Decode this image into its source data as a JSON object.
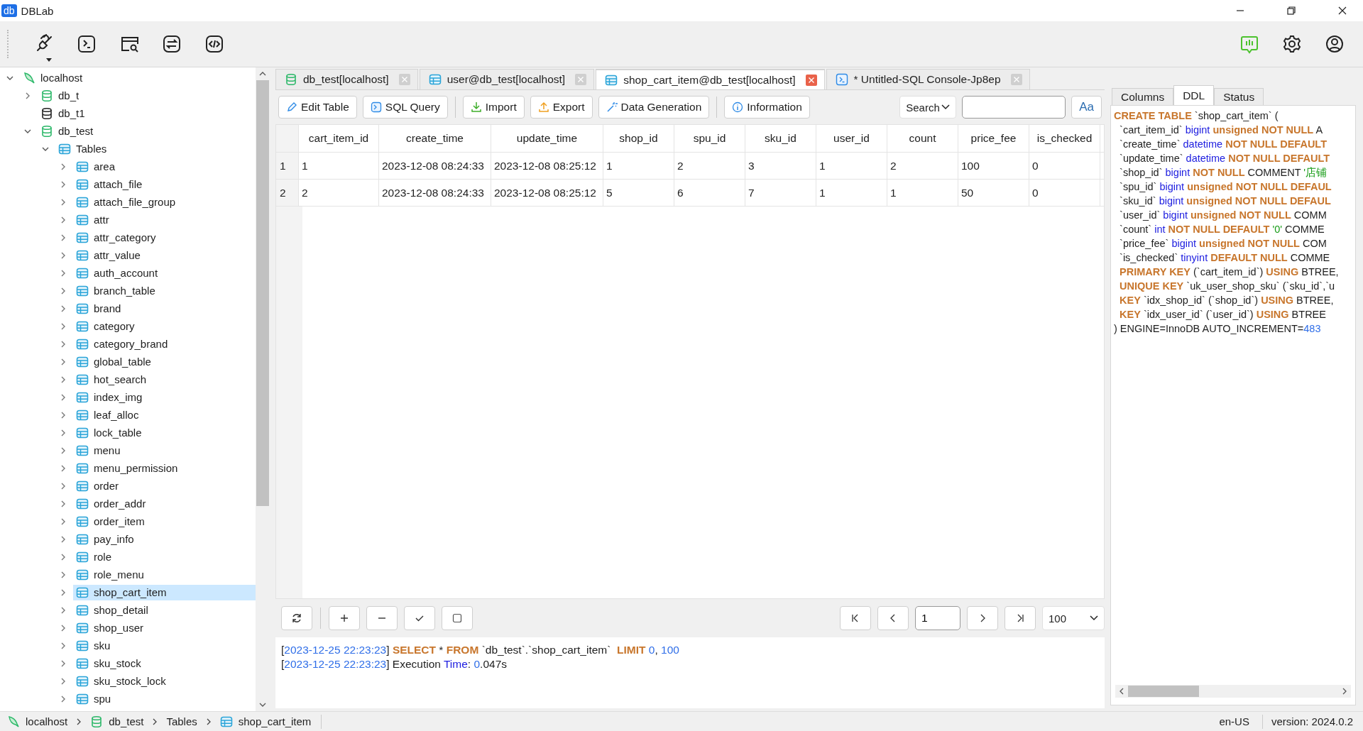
{
  "window": {
    "logo": "db",
    "title": "DBLab"
  },
  "toolbar": {
    "left": [
      {
        "kind": "plug-menu"
      },
      {
        "kind": "terminal"
      },
      {
        "kind": "window-search"
      },
      {
        "kind": "swap"
      },
      {
        "kind": "code"
      }
    ],
    "right": [
      {
        "kind": "feedback"
      },
      {
        "kind": "settings"
      },
      {
        "kind": "account"
      }
    ]
  },
  "tree": [
    {
      "label": "localhost",
      "kind": "server",
      "expanded": true,
      "selected": false,
      "children": [
        {
          "label": "db_t",
          "kind": "database",
          "expanded": false,
          "selected": false
        },
        {
          "label": "db_t1",
          "kind": "database-offline",
          "selected": false
        },
        {
          "label": "db_test",
          "kind": "database",
          "expanded": true,
          "selected": false,
          "children": [
            {
              "label": "Tables",
              "kind": "folder",
              "expanded": true,
              "selected": false,
              "children": [
                {
                  "label": "area",
                  "kind": "table",
                  "expanded": false,
                  "selected": false
                },
                {
                  "label": "attach_file",
                  "kind": "table",
                  "expanded": false,
                  "selected": false
                },
                {
                  "label": "attach_file_group",
                  "kind": "table",
                  "expanded": false,
                  "selected": false
                },
                {
                  "label": "attr",
                  "kind": "table",
                  "expanded": false,
                  "selected": false
                },
                {
                  "label": "attr_category",
                  "kind": "table",
                  "expanded": false,
                  "selected": false
                },
                {
                  "label": "attr_value",
                  "kind": "table",
                  "expanded": false,
                  "selected": false
                },
                {
                  "label": "auth_account",
                  "kind": "table",
                  "expanded": false,
                  "selected": false
                },
                {
                  "label": "branch_table",
                  "kind": "table",
                  "expanded": false,
                  "selected": false
                },
                {
                  "label": "brand",
                  "kind": "table",
                  "expanded": false,
                  "selected": false
                },
                {
                  "label": "category",
                  "kind": "table",
                  "expanded": false,
                  "selected": false
                },
                {
                  "label": "category_brand",
                  "kind": "table",
                  "expanded": false,
                  "selected": false
                },
                {
                  "label": "global_table",
                  "kind": "table",
                  "expanded": false,
                  "selected": false
                },
                {
                  "label": "hot_search",
                  "kind": "table",
                  "expanded": false,
                  "selected": false
                },
                {
                  "label": "index_img",
                  "kind": "table",
                  "expanded": false,
                  "selected": false
                },
                {
                  "label": "leaf_alloc",
                  "kind": "table",
                  "expanded": false,
                  "selected": false
                },
                {
                  "label": "lock_table",
                  "kind": "table",
                  "expanded": false,
                  "selected": false
                },
                {
                  "label": "menu",
                  "kind": "table",
                  "expanded": false,
                  "selected": false
                },
                {
                  "label": "menu_permission",
                  "kind": "table",
                  "expanded": false,
                  "selected": false
                },
                {
                  "label": "order",
                  "kind": "table",
                  "expanded": false,
                  "selected": false
                },
                {
                  "label": "order_addr",
                  "kind": "table",
                  "expanded": false,
                  "selected": false
                },
                {
                  "label": "order_item",
                  "kind": "table",
                  "expanded": false,
                  "selected": false
                },
                {
                  "label": "pay_info",
                  "kind": "table",
                  "expanded": false,
                  "selected": false
                },
                {
                  "label": "role",
                  "kind": "table",
                  "expanded": false,
                  "selected": false
                },
                {
                  "label": "role_menu",
                  "kind": "table",
                  "expanded": false,
                  "selected": false
                },
                {
                  "label": "shop_cart_item",
                  "kind": "table",
                  "expanded": false,
                  "selected": true
                },
                {
                  "label": "shop_detail",
                  "kind": "table",
                  "expanded": false,
                  "selected": false
                },
                {
                  "label": "shop_user",
                  "kind": "table",
                  "expanded": false,
                  "selected": false
                },
                {
                  "label": "sku",
                  "kind": "table",
                  "expanded": false,
                  "selected": false
                },
                {
                  "label": "sku_stock",
                  "kind": "table",
                  "expanded": false,
                  "selected": false
                },
                {
                  "label": "sku_stock_lock",
                  "kind": "table",
                  "expanded": false,
                  "selected": false
                },
                {
                  "label": "spu",
                  "kind": "table",
                  "expanded": false,
                  "selected": false
                }
              ]
            }
          ]
        }
      ]
    }
  ],
  "tabs": [
    {
      "label": "db_test[localhost]",
      "kind": "database",
      "selected": false
    },
    {
      "label": "user@db_test[localhost]",
      "kind": "table",
      "selected": false
    },
    {
      "label": "shop_cart_item@db_test[localhost]",
      "kind": "table",
      "selected": true
    },
    {
      "label": "* Untitled-SQL Console-Jp8ep",
      "kind": "console",
      "selected": false
    }
  ],
  "action_groups": [
    [
      {
        "label": "Edit Table",
        "kind": "edit"
      },
      {
        "label": "SQL Query",
        "kind": "query"
      }
    ],
    [
      {
        "label": "Import",
        "kind": "import"
      },
      {
        "label": "Export",
        "kind": "export"
      },
      {
        "label": "Data Generation",
        "kind": "generate"
      }
    ],
    [
      {
        "label": "Information",
        "kind": "info"
      }
    ]
  ],
  "search": {
    "mode": "Search",
    "case_button": "Aa"
  },
  "grid": {
    "columns": [
      "cart_item_id",
      "create_time",
      "update_time",
      "shop_id",
      "spu_id",
      "sku_id",
      "user_id",
      "count",
      "price_fee",
      "is_checked"
    ],
    "rows": [
      {
        "number": "1",
        "cells": [
          "1",
          "2023-12-08 08:24:33",
          "2023-12-08 08:25:12",
          "1",
          "2",
          "3",
          "1",
          "2",
          "100",
          "0"
        ]
      },
      {
        "number": "2",
        "cells": [
          "2",
          "2023-12-08 08:24:33",
          "2023-12-08 08:25:12",
          "5",
          "6",
          "7",
          "1",
          "1",
          "50",
          "0"
        ]
      }
    ]
  },
  "grid_tools": [
    {
      "kind": "refresh"
    },
    {
      "kind": "add"
    },
    {
      "kind": "remove"
    },
    {
      "kind": "apply"
    },
    {
      "kind": "cancel"
    }
  ],
  "pager": {
    "page": "1",
    "page_size": "100"
  },
  "log": [
    [
      {
        "text": "[",
        "kind": "plain"
      },
      {
        "text": "2023-12-25 22:23:23",
        "kind": "num"
      },
      {
        "text": "] ",
        "kind": "plain"
      },
      {
        "text": "SELECT",
        "kind": "kw"
      },
      {
        "text": " * ",
        "kind": "plain"
      },
      {
        "text": "FROM",
        "kind": "kw"
      },
      {
        "text": " `db_test`.`shop_cart_item`  ",
        "kind": "plain"
      },
      {
        "text": "LIMIT",
        "kind": "kw"
      },
      {
        "text": " 0",
        "kind": "num"
      },
      {
        "text": ", ",
        "kind": "plain"
      },
      {
        "text": "100",
        "kind": "num"
      }
    ],
    [
      {
        "text": "[",
        "kind": "plain"
      },
      {
        "text": "2023-12-25 22:23:23",
        "kind": "num"
      },
      {
        "text": "] Execution ",
        "kind": "plain"
      },
      {
        "text": "Time",
        "kind": "type"
      },
      {
        "text": ": ",
        "kind": "plain"
      },
      {
        "text": "0",
        "kind": "num"
      },
      {
        "text": ".047s",
        "kind": "plain"
      }
    ]
  ],
  "side_tabs": [
    {
      "label": "Columns",
      "selected": false
    },
    {
      "label": "DDL",
      "selected": true
    },
    {
      "label": "Status",
      "selected": false
    }
  ],
  "ddl": [
    [
      {
        "text": "CREATE TABLE",
        "kind": "kw"
      },
      {
        "text": " `shop_cart_item` (",
        "kind": "plain"
      }
    ],
    [
      {
        "text": "  `cart_item_id` ",
        "kind": "plain"
      },
      {
        "text": "bigint",
        "kind": "type"
      },
      {
        "text": " unsigned NOT NULL",
        "kind": "kw"
      },
      {
        "text": " A",
        "kind": "plain"
      }
    ],
    [
      {
        "text": "  `create_time` ",
        "kind": "plain"
      },
      {
        "text": "datetime",
        "kind": "type"
      },
      {
        "text": " NOT NULL DEFAULT",
        "kind": "kw"
      }
    ],
    [
      {
        "text": "  `update_time` ",
        "kind": "plain"
      },
      {
        "text": "datetime",
        "kind": "type"
      },
      {
        "text": " NOT NULL DEFAULT",
        "kind": "kw"
      }
    ],
    [
      {
        "text": "  `shop_id` ",
        "kind": "plain"
      },
      {
        "text": "bigint",
        "kind": "type"
      },
      {
        "text": " NOT NULL",
        "kind": "kw"
      },
      {
        "text": " COMMENT ",
        "kind": "plain"
      },
      {
        "text": "'店铺",
        "kind": "str"
      }
    ],
    [
      {
        "text": "  `spu_id` ",
        "kind": "plain"
      },
      {
        "text": "bigint",
        "kind": "type"
      },
      {
        "text": " unsigned NOT NULL DEFAUL",
        "kind": "kw"
      }
    ],
    [
      {
        "text": "  `sku_id` ",
        "kind": "plain"
      },
      {
        "text": "bigint",
        "kind": "type"
      },
      {
        "text": " unsigned NOT NULL DEFAUL",
        "kind": "kw"
      }
    ],
    [
      {
        "text": "  `user_id` ",
        "kind": "plain"
      },
      {
        "text": "bigint",
        "kind": "type"
      },
      {
        "text": " unsigned NOT NULL",
        "kind": "kw"
      },
      {
        "text": " COMM",
        "kind": "plain"
      }
    ],
    [
      {
        "text": "  `count` ",
        "kind": "plain"
      },
      {
        "text": "int",
        "kind": "type"
      },
      {
        "text": " NOT NULL DEFAULT",
        "kind": "kw"
      },
      {
        "text": " '0'",
        "kind": "str"
      },
      {
        "text": " COMME",
        "kind": "plain"
      }
    ],
    [
      {
        "text": "  `price_fee` ",
        "kind": "plain"
      },
      {
        "text": "bigint",
        "kind": "type"
      },
      {
        "text": " unsigned NOT NULL",
        "kind": "kw"
      },
      {
        "text": " COM",
        "kind": "plain"
      }
    ],
    [
      {
        "text": "  `is_checked` ",
        "kind": "plain"
      },
      {
        "text": "tinyint",
        "kind": "type"
      },
      {
        "text": " DEFAULT NULL",
        "kind": "kw"
      },
      {
        "text": " COMME",
        "kind": "plain"
      }
    ],
    [
      {
        "text": "  PRIMARY KEY",
        "kind": "kw"
      },
      {
        "text": " (`cart_item_id`) ",
        "kind": "plain"
      },
      {
        "text": "USING",
        "kind": "kw"
      },
      {
        "text": " BTREE,",
        "kind": "plain"
      }
    ],
    [
      {
        "text": "  UNIQUE KEY",
        "kind": "kw"
      },
      {
        "text": " `uk_user_shop_sku` (`sku_id`,`u",
        "kind": "plain"
      }
    ],
    [
      {
        "text": "  KEY",
        "kind": "kw"
      },
      {
        "text": " `idx_shop_id` (`shop_id`) ",
        "kind": "plain"
      },
      {
        "text": "USING",
        "kind": "kw"
      },
      {
        "text": " BTREE,",
        "kind": "plain"
      }
    ],
    [
      {
        "text": "  KEY",
        "kind": "kw"
      },
      {
        "text": " `idx_user_id` (`user_id`) ",
        "kind": "plain"
      },
      {
        "text": "USING",
        "kind": "kw"
      },
      {
        "text": " BTREE",
        "kind": "plain"
      }
    ],
    [
      {
        "text": ") ENGINE=InnoDB AUTO_INCREMENT=",
        "kind": "plain"
      },
      {
        "text": "483",
        "kind": "num"
      }
    ]
  ],
  "status_bar": {
    "breadcrumb": [
      {
        "label": "localhost",
        "kind": "server"
      },
      {
        "label": "db_test",
        "kind": "database"
      },
      {
        "label": "Tables",
        "kind": "folder"
      },
      {
        "label": "shop_cart_item",
        "kind": "table"
      }
    ],
    "locale": "en-US",
    "version": "version: 2024.0.2"
  }
}
